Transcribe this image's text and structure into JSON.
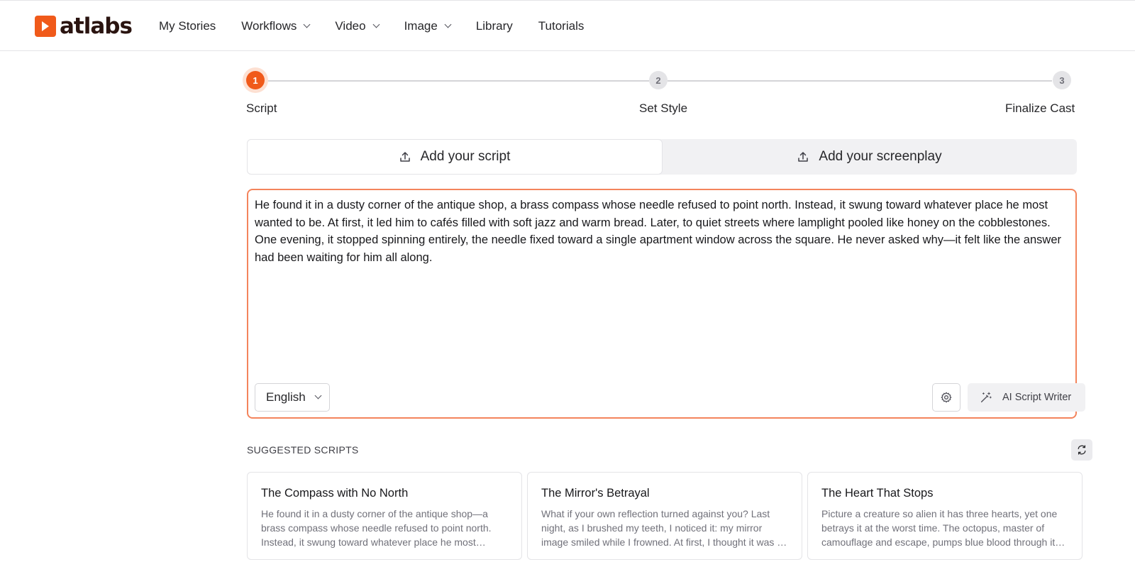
{
  "brand": {
    "name": "atlabs",
    "accent": "#f05a1a"
  },
  "nav": {
    "items": [
      {
        "label": "My Stories",
        "dropdown": false
      },
      {
        "label": "Workflows",
        "dropdown": true
      },
      {
        "label": "Video",
        "dropdown": true
      },
      {
        "label": "Image",
        "dropdown": true
      },
      {
        "label": "Library",
        "dropdown": false
      },
      {
        "label": "Tutorials",
        "dropdown": false
      }
    ]
  },
  "stepper": {
    "current": 1,
    "steps": [
      {
        "number": "1",
        "label": "Script"
      },
      {
        "number": "2",
        "label": "Set Style"
      },
      {
        "number": "3",
        "label": "Finalize Cast"
      }
    ]
  },
  "tabs": [
    {
      "label": "Add your script",
      "icon": "upload-icon",
      "active": true
    },
    {
      "label": "Add your screenplay",
      "icon": "upload-icon",
      "active": false
    }
  ],
  "editor": {
    "text": "He found it in a dusty corner of the antique shop, a brass compass whose needle refused to point north. Instead, it swung toward whatever place he most wanted to be. At first, it led him to cafés filled with soft jazz and warm bread. Later, to quiet streets where lamplight pooled like honey on the cobblestones. One evening, it stopped spinning entirely, the needle fixed toward a single apartment window across the square. He never asked why—it felt like the answer had been waiting for him all along.",
    "language": "English",
    "settings_icon": "gear-icon",
    "ai_button_label": "AI Script Writer",
    "ai_button_icon": "magic-wand-icon"
  },
  "suggested": {
    "heading": "SUGGESTED SCRIPTS",
    "refresh_icon": "refresh-icon",
    "cards": [
      {
        "title": "The Compass with No North",
        "excerpt": "He found it in a dusty corner of the antique shop—a brass compass whose needle refused to point north. Instead, it swung toward whatever place he most wanted to be."
      },
      {
        "title": "The Mirror's Betrayal",
        "excerpt": "What if your own reflection turned against you? Last night, as I brushed my teeth, I noticed it: my mirror image smiled while I frowned. At first, I thought it was a trick of the light."
      },
      {
        "title": "The Heart That Stops",
        "excerpt": "Picture a creature so alien it has three hearts, yet one betrays it at the worst time. The octopus, master of camouflage and escape, pumps blue blood through its body."
      }
    ]
  }
}
